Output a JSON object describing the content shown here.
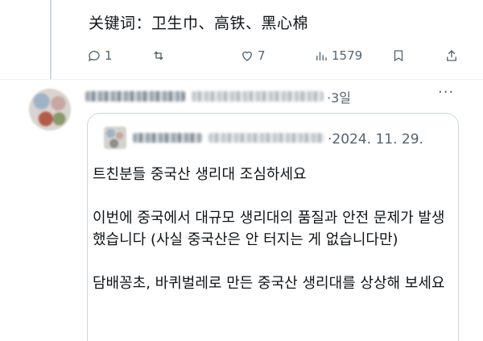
{
  "previous_tweet": {
    "text": "关键词：卫生巾、高铁、黑心棉"
  },
  "actions": {
    "reply_count": "1",
    "retweet_count": "",
    "like_count": "7",
    "view_count": "1579"
  },
  "reply": {
    "time_ago": "·3일",
    "more": "···"
  },
  "quoted": {
    "date": "·2024. 11. 29.",
    "paragraphs": [
      "트친분들 중국산 생리대 조심하세요",
      "이번에 중국에서 대규모 생리대의 품질과 안전 문제가 발생했습니다 (사실 중국산은 안 터지는 게 없습니다만)",
      "담배꽁초, 바퀴벌레로 만든 중국산 생리대를 상상해 보세요"
    ]
  }
}
